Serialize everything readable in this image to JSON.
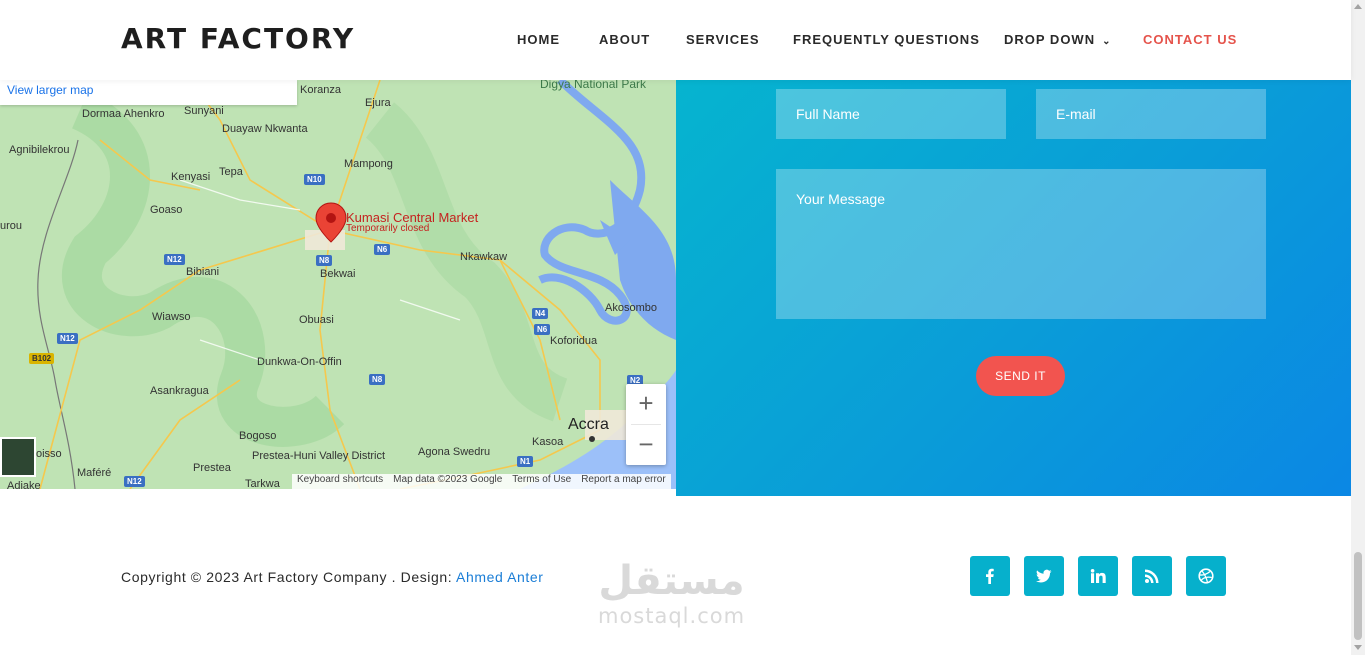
{
  "header": {
    "logo": "ART FACTORY",
    "nav": [
      {
        "label": "HOME"
      },
      {
        "label": "ABOUT"
      },
      {
        "label": "SERVICES"
      },
      {
        "label": "FREQUENTLY QUESTIONS"
      },
      {
        "label": "DROP DOWN"
      },
      {
        "label": "CONTACT US"
      }
    ]
  },
  "map": {
    "larger_map_link": "View larger map",
    "pin_title": "Kumasi Central Market",
    "pin_status": "Temporarily closed",
    "places": [
      "Digya National Park",
      "Koranza",
      "Ejura",
      "Sunyani",
      "Dormaa Ahenkro",
      "Duayaw Nkwanta",
      "Agnibilekrou",
      "Mampong",
      "Kenyasi",
      "Tepa",
      "Goaso",
      "Bibiani",
      "Bekwai",
      "Nkawkaw",
      "Akosombo",
      "Wiawso",
      "Obuasi",
      "Koforidua",
      "Dunkwa-On-Offin",
      "Asankragua",
      "Bogoso",
      "Prestea",
      "Prestea-Huni Valley District",
      "Tarkwa",
      "Agona Swedru",
      "Kasoa",
      "Accra",
      "Maféré",
      "Adiake",
      "urou",
      "oisso"
    ],
    "roads": [
      "N10",
      "N12",
      "N8",
      "N6",
      "N4",
      "N6",
      "N12",
      "B102",
      "N8",
      "N2",
      "N1",
      "N12"
    ],
    "zoom_in": "+",
    "zoom_out": "−",
    "footer": [
      "Keyboard shortcuts",
      "Map data ©2023 Google",
      "Terms of Use",
      "Report a map error"
    ]
  },
  "contact": {
    "full_name_placeholder": "Full Name",
    "email_placeholder": "E-mail",
    "message_placeholder": "Your Message",
    "send_label": "SEND IT"
  },
  "footer": {
    "copyright": "Copyright © 2023 Art Factory Company . Design: ",
    "designer": "Ahmed Anter",
    "social": [
      {
        "icon": "facebook-icon"
      },
      {
        "icon": "twitter-icon"
      },
      {
        "icon": "linkedin-icon"
      },
      {
        "icon": "rss-icon"
      },
      {
        "icon": "dribbble-icon"
      }
    ],
    "watermark_ar": "مستقل",
    "watermark_lat": "mostaql.com"
  },
  "colors": {
    "accent": "#e5534b",
    "teal": "#06b0cc",
    "link": "#1a7dd6"
  }
}
